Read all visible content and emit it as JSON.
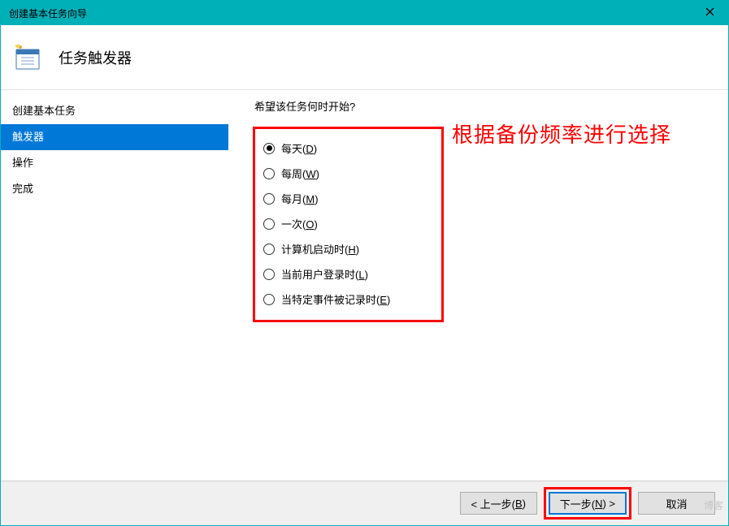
{
  "titlebar": {
    "title": "创建基本任务向导"
  },
  "header": {
    "title": "任务触发器"
  },
  "sidebar": {
    "items": [
      {
        "label": "创建基本任务",
        "active": false
      },
      {
        "label": "触发器",
        "active": true
      },
      {
        "label": "操作",
        "active": false
      },
      {
        "label": "完成",
        "active": false
      }
    ]
  },
  "content": {
    "question": "希望该任务何时开始?",
    "options": [
      {
        "label": "每天(",
        "hotkey": "D",
        "after": ")",
        "selected": true
      },
      {
        "label": "每周(",
        "hotkey": "W",
        "after": ")",
        "selected": false
      },
      {
        "label": "每月(",
        "hotkey": "M",
        "after": ")",
        "selected": false
      },
      {
        "label": "一次(",
        "hotkey": "O",
        "after": ")",
        "selected": false
      },
      {
        "label": "计算机启动时(",
        "hotkey": "H",
        "after": ")",
        "selected": false
      },
      {
        "label": "当前用户登录时(",
        "hotkey": "L",
        "after": ")",
        "selected": false
      },
      {
        "label": "当特定事件被记录时(",
        "hotkey": "E",
        "after": ")",
        "selected": false
      }
    ],
    "annotation": "根据备份频率进行选择"
  },
  "footer": {
    "back_pre": "< 上一步(",
    "back_hot": "B",
    "back_post": ")",
    "next_pre": "下一步(",
    "next_hot": "N",
    "next_post": ") >",
    "cancel": "取消"
  },
  "watermark": "博客"
}
